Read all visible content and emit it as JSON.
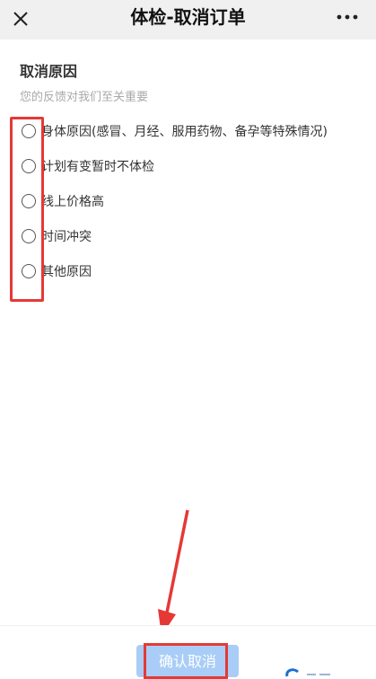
{
  "header": {
    "title": "体检-取消订单",
    "close_icon": "close-icon",
    "more_icon": "more-icon"
  },
  "section": {
    "title": "取消原因",
    "subtitle": "您的反馈对我们至关重要"
  },
  "options": [
    {
      "label": "身体原因(感冒、月经、服用药物、备孕等特殊情况)",
      "selected": false
    },
    {
      "label": "计划有变暂时不体检",
      "selected": false
    },
    {
      "label": "线上价格高",
      "selected": false
    },
    {
      "label": "时间冲突",
      "selected": false
    },
    {
      "label": "其他原因",
      "selected": false
    }
  ],
  "footer": {
    "confirm_label": "确认取消"
  },
  "colors": {
    "highlight": "#e53935",
    "button_bg": "#a9cdf6"
  }
}
